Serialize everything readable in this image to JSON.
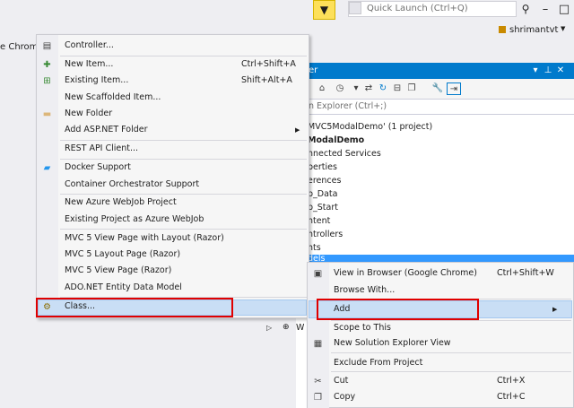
{
  "topbar": {
    "quick_launch_placeholder": "Quick Launch (Ctrl+Q)",
    "user_name": "shrimantvt",
    "background_window_text": "e Chrome"
  },
  "solution_explorer": {
    "header_title": "er",
    "search_placeholder": "n Explorer (Ctrl+;)",
    "tree_items": [
      "MVC5ModalDemo' (1 project)",
      "ModalDemo",
      "nnected Services",
      "perties",
      "erences",
      "p_Data",
      "p_Start",
      "ntent",
      "ntrollers",
      "nts",
      "dels"
    ],
    "partial_items": [
      "W"
    ]
  },
  "add_menu": {
    "items": [
      {
        "label": "Controller...",
        "shortcut": "",
        "icon": "controller-icon"
      },
      {
        "label": "New Item...",
        "shortcut": "Ctrl+Shift+A",
        "icon": "new-item-icon"
      },
      {
        "label": "Existing Item...",
        "shortcut": "Shift+Alt+A",
        "icon": "existing-item-icon"
      },
      {
        "label": "New Scaffolded Item...",
        "shortcut": "",
        "icon": ""
      },
      {
        "label": "New Folder",
        "shortcut": "",
        "icon": "folder-icon"
      },
      {
        "label": "Add ASP.NET Folder",
        "shortcut": "",
        "icon": "",
        "submenu": true
      },
      {
        "label": "REST API Client...",
        "shortcut": "",
        "icon": ""
      },
      {
        "label": "Docker Support",
        "shortcut": "",
        "icon": "docker-icon"
      },
      {
        "label": "Container Orchestrator Support",
        "shortcut": "",
        "icon": ""
      },
      {
        "label": "New Azure WebJob Project",
        "shortcut": "",
        "icon": ""
      },
      {
        "label": "Existing Project as Azure WebJob",
        "shortcut": "",
        "icon": ""
      },
      {
        "label": "MVC 5 View Page with Layout (Razor)",
        "shortcut": "",
        "icon": ""
      },
      {
        "label": "MVC 5 Layout Page (Razor)",
        "shortcut": "",
        "icon": ""
      },
      {
        "label": "MVC 5 View Page (Razor)",
        "shortcut": "",
        "icon": ""
      },
      {
        "label": "ADO.NET Entity Data Model",
        "shortcut": "",
        "icon": ""
      },
      {
        "label": "Class...",
        "shortcut": "",
        "icon": "class-icon",
        "highlighted": true
      }
    ]
  },
  "context_menu": {
    "items": [
      {
        "label": "View in Browser (Google Chrome)",
        "shortcut": "Ctrl+Shift+W",
        "icon": "browser-icon"
      },
      {
        "label": "Browse With...",
        "shortcut": "",
        "icon": ""
      },
      {
        "label": "Add",
        "shortcut": "",
        "icon": "",
        "submenu": true,
        "highlighted": true
      },
      {
        "label": "Scope to This",
        "shortcut": "",
        "icon": ""
      },
      {
        "label": "New Solution Explorer View",
        "shortcut": "",
        "icon": "new-view-icon"
      },
      {
        "label": "Exclude From Project",
        "shortcut": "",
        "icon": ""
      },
      {
        "label": "Cut",
        "shortcut": "Ctrl+X",
        "icon": "scissors-icon"
      },
      {
        "label": "Copy",
        "shortcut": "Ctrl+C",
        "icon": "copy-icon"
      }
    ]
  },
  "colors": {
    "accent": "#007acc",
    "highlight": "#c9def5",
    "annotation_red": "#e00000",
    "filter_yellow": "#fde05a"
  }
}
